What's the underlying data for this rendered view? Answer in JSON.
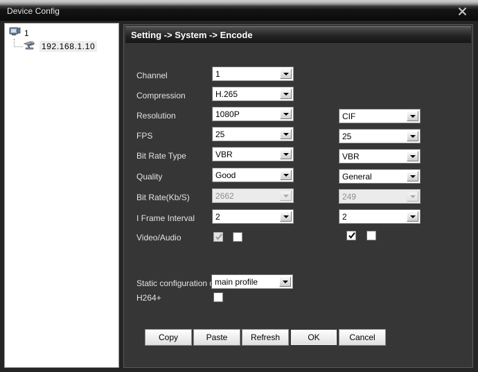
{
  "window": {
    "title": "Device Config",
    "close_icon": "close-icon"
  },
  "sidebar": {
    "root": {
      "label": "1",
      "icon": "device-group-icon"
    },
    "child": {
      "label": "192.168.1.10",
      "icon": "camera-device-icon"
    }
  },
  "content": {
    "header": "Setting -> System -> Encode",
    "rows": [
      {
        "label": "Channel",
        "main": "1",
        "sub": null
      },
      {
        "label": "Compression",
        "main": "H.265",
        "sub": null
      },
      {
        "label": "Resolution",
        "main": "1080P",
        "sub": "CIF"
      },
      {
        "label": "FPS",
        "main": "25",
        "sub": "25"
      },
      {
        "label": "Bit Rate Type",
        "main": "VBR",
        "sub": "VBR"
      },
      {
        "label": "Quality",
        "main": "Good",
        "sub": "General"
      },
      {
        "label": "Bit Rate(Kb/S)",
        "main": "2662",
        "sub": "249"
      },
      {
        "label": "I Frame Interval",
        "main": "2",
        "sub": "2"
      },
      {
        "label": "Video/Audio",
        "main": null,
        "sub": null
      }
    ],
    "static_config": {
      "label": "Static configuration of",
      "value": "main profile"
    },
    "h264plus": {
      "label": "H264+"
    }
  },
  "buttons": {
    "copy": "Copy",
    "paste": "Paste",
    "refresh": "Refresh",
    "ok": "OK",
    "cancel": "Cancel"
  },
  "colors": {
    "panel_bg": "#363636",
    "window_bg": "#252525",
    "titlebar_text": "#e9e9e9",
    "label_text": "#e3e3e3"
  }
}
